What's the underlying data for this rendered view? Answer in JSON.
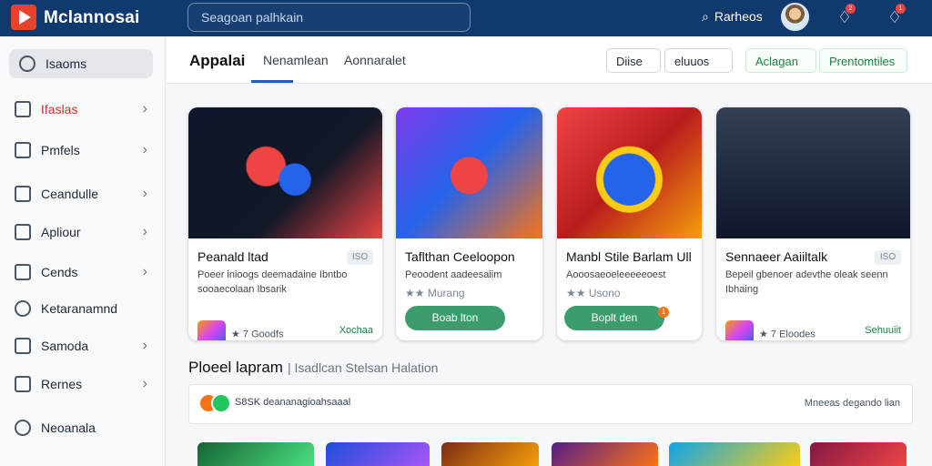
{
  "brand": {
    "name": "Mclannosai"
  },
  "search": {
    "placeholder": "Seagoan palhkain"
  },
  "header": {
    "search_label": "Rarheos",
    "notifications": [
      {
        "count": "2"
      },
      {
        "count": "1"
      }
    ]
  },
  "sidebar": {
    "active": "Isaoms",
    "items": [
      {
        "label": "Ifaslas",
        "highlight": true
      },
      {
        "label": "Pmfels"
      },
      {
        "label": "Ceandulle"
      },
      {
        "label": "Apliour"
      },
      {
        "label": "Cends"
      },
      {
        "label": "Ketaranamnd"
      },
      {
        "label": "Samoda"
      },
      {
        "label": "Rernes"
      },
      {
        "label": "Neoanala"
      }
    ]
  },
  "tabs": {
    "items": [
      "Appalai",
      "Nenamlean",
      "Aonnaralet"
    ],
    "actions": [
      "Diise",
      "eluuos",
      "Aclagan",
      "Prentomtiles"
    ]
  },
  "cards": [
    {
      "title": "Peanald ltad",
      "badge": "ISO",
      "description": "Poeer inioogs deemadaine Ibntbo sooaecolaan Ibsarik",
      "rating": "★ 7 Goodfs",
      "install": "Xochaa",
      "colors": [
        "#0f172a",
        "#2563eb",
        "#ef4444"
      ]
    },
    {
      "title": "Taflthan Ceeloopon",
      "badge": "",
      "description": "Peoodent aadeesaiim",
      "stars": "★★ Murang",
      "action": "Boab lton",
      "colors": [
        "#f97316",
        "#2563eb",
        "#facc15"
      ]
    },
    {
      "title": "Manbl Stile Barlam Ull",
      "badge": "",
      "description": "Aooosaeoeleeeeeoest",
      "stars": "★★ Usono",
      "action": "Boplt den",
      "colors": [
        "#dc2626",
        "#facc15",
        "#0ea5e9"
      ],
      "dot": "1"
    },
    {
      "title": "Sennaeer Aaiiltalk",
      "badge": "ISO",
      "description": "Bepeil gbenoer adevthe oleak seenn Ibhaing",
      "rating": "★ 7 Eloodes",
      "install": "Sehuuiit",
      "colors": [
        "#334155",
        "#0f172a",
        "#f59e0b"
      ]
    }
  ],
  "section": {
    "title": "Ploeel lapram",
    "subtitle": "| Isadlcan Stelsan Halation"
  },
  "panel": {
    "left": "S8SK deananagioahsaaal",
    "right": "Mneeas degando lian"
  }
}
